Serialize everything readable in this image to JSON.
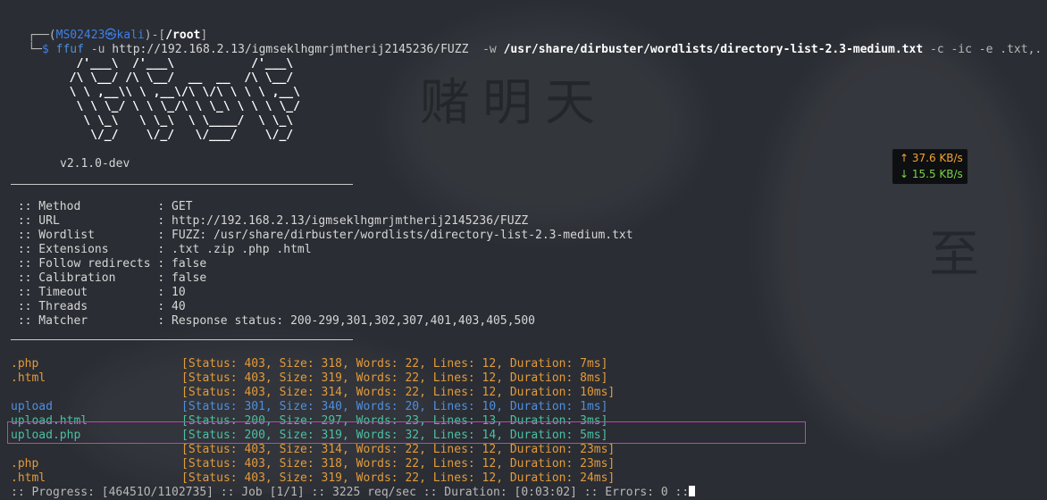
{
  "prompt": {
    "corner_top": "┌──(",
    "user": "MS02423",
    "at": "㉿",
    "host": "kali",
    "sep": ")-[",
    "cwd": "/root",
    "close": "]",
    "corner_bottom": "└─",
    "dollar": "$"
  },
  "command": {
    "bin": "ffuf",
    "flag_u": "-u",
    "url": "http://192.168.2.13/igmseklhgmrjmtherij2145236/FUZZ",
    "flag_w": "-w",
    "wordlist": "/usr/share/dirbuster/wordlists/directory-list-2.3-medium.txt",
    "flags_rest": "-c -ic -e .txt,."
  },
  "banner": {
    "art": [
      "   /'___\\  /'___\\           /'___\\",
      "  /\\ \\__/ /\\ \\__/  __  __  /\\ \\__/",
      "  \\ \\ ,__\\\\ \\ ,__\\/\\ \\/\\ \\ \\ \\ ,__\\",
      "   \\ \\ \\_/ \\ \\ \\_/\\ \\ \\_\\ \\ \\ \\ \\_/",
      "    \\ \\_\\   \\ \\_\\  \\ \\____/  \\ \\_\\",
      "     \\/_/    \\/_/   \\/___/    \\/_/"
    ],
    "version": "v2.1.0-dev"
  },
  "config": [
    {
      "key": " :: Method           :",
      "value": " GET"
    },
    {
      "key": " :: URL              :",
      "value": " http://192.168.2.13/igmseklhgmrjmtherij2145236/FUZZ"
    },
    {
      "key": " :: Wordlist         :",
      "value": " FUZZ: /usr/share/dirbuster/wordlists/directory-list-2.3-medium.txt"
    },
    {
      "key": " :: Extensions       :",
      "value": " .txt .zip .php .html"
    },
    {
      "key": " :: Follow redirects :",
      "value": " false"
    },
    {
      "key": " :: Calibration      :",
      "value": " false"
    },
    {
      "key": " :: Timeout          :",
      "value": " 10"
    },
    {
      "key": " :: Threads          :",
      "value": " 40"
    },
    {
      "key": " :: Matcher          :",
      "value": " Response status: 200-299,301,302,307,401,403,405,500"
    }
  ],
  "results": [
    {
      "name": ".php",
      "status": "[Status: 403, Size: 318, Words: 22, Lines: 12, Duration: 7ms]",
      "color": "#e39a3b"
    },
    {
      "name": ".html",
      "status": "[Status: 403, Size: 319, Words: 22, Lines: 12, Duration: 8ms]",
      "color": "#e39a3b"
    },
    {
      "name": "",
      "status": "[Status: 403, Size: 314, Words: 22, Lines: 12, Duration: 10ms]",
      "color": "#e39a3b"
    },
    {
      "name": "upload",
      "status": "[Status: 301, Size: 340, Words: 20, Lines: 10, Duration: 1ms]",
      "color": "#4e8fe0"
    },
    {
      "name": "upload.html",
      "status": "[Status: 200, Size: 297, Words: 23, Lines: 13, Duration: 3ms]",
      "color": "#4dbfa2"
    },
    {
      "name": "upload.php",
      "status": "[Status: 200, Size: 319, Words: 32, Lines: 14, Duration: 5ms]",
      "color": "#4dbfa2"
    },
    {
      "name": "",
      "status": "[Status: 403, Size: 314, Words: 22, Lines: 12, Duration: 23ms]",
      "color": "#e39a3b"
    },
    {
      "name": ".php",
      "status": "[Status: 403, Size: 318, Words: 22, Lines: 12, Duration: 23ms]",
      "color": "#e39a3b"
    },
    {
      "name": ".html",
      "status": "[Status: 403, Size: 319, Words: 22, Lines: 12, Duration: 24ms]",
      "color": "#e39a3b"
    }
  ],
  "progress": ":: Progress: [46451O/1102735] :: Job [1/1] :: 3225 req/sec :: Duration: [0:03:02] :: Errors: 0 ::",
  "net_monitor": {
    "up": "↑ 37.6 KB/s",
    "down": "↓ 15.5 KB/s"
  },
  "colors": {
    "background": "#2a2d33",
    "prompt_user": "#3f7fe8",
    "status_403": "#e39a3b",
    "status_301": "#4e8fe0",
    "status_200": "#4dbfa2",
    "highlight_box": "#c73fbf"
  }
}
